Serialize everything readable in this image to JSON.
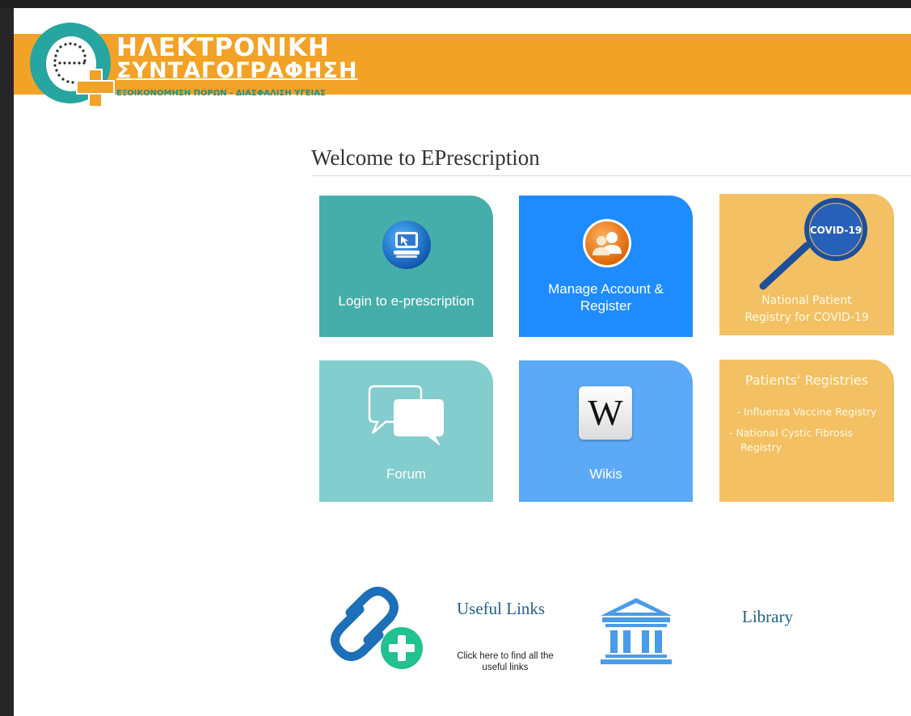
{
  "logo": {
    "line1": "ΗΛΕΚΤΡΟΝΙΚΗ",
    "line2": "ΣΥΝΤΑΓΟΓΡΑΦΗΣΗ",
    "line3": "ΕΞΟΙΚΟΝΟΜΗΣΗ ΠΟΡΩΝ - ΔΙΑΣΦΑΛΙΣΗ ΥΓΕΙΑΣ"
  },
  "welcome_title": "Welcome to EPrescription",
  "tiles": {
    "login": "Login to e-prescription",
    "manage_line1": "Manage Account &",
    "manage_line2": "Register",
    "covid_badge": "COVID-19",
    "covid_line1": "National Patient",
    "covid_line2": "Registry for COVID-19",
    "forum": "Forum",
    "wikis": "Wikis",
    "wiki_glyph": "W",
    "registries_title": "Patients' Registries",
    "registry_item1": "- Influenza Vaccine Registry",
    "registry_item2_line1": "- National Cystic Fibrosis",
    "registry_item2_line2": "Registry"
  },
  "useful_links": {
    "title": "Useful Links",
    "desc_line1": "Click here to find all the",
    "desc_line2": "useful links"
  },
  "library": {
    "title": "Library"
  },
  "colors": {
    "banner": "#f2a227",
    "teal": "#46aeaa",
    "blue": "#1e8cff",
    "orange_tile": "#f3c063",
    "light_teal": "#84cdce",
    "light_blue": "#5caaf7",
    "link_title": "#1f5f8b"
  }
}
